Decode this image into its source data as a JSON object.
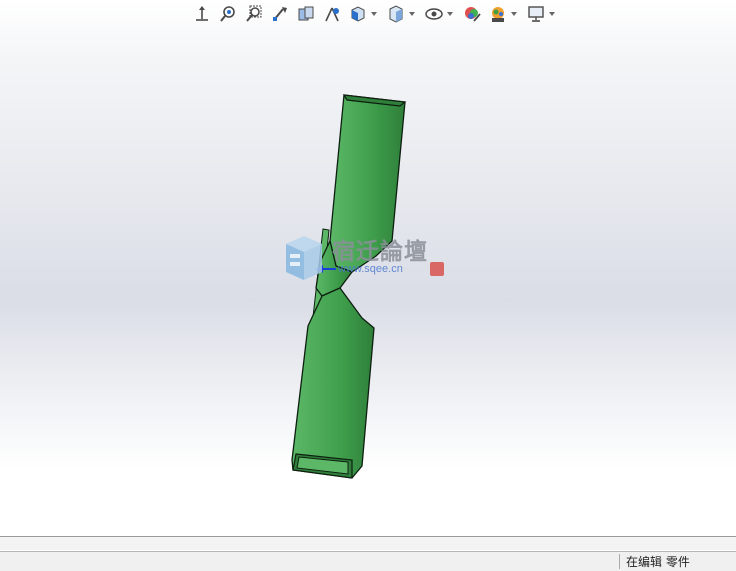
{
  "toolbar": {
    "items": [
      {
        "icon": "view-orientation-icon",
        "dropdown": false
      },
      {
        "icon": "zoom-to-fit-icon",
        "dropdown": false
      },
      {
        "icon": "zoom-to-area-icon",
        "dropdown": false
      },
      {
        "icon": "previous-view-icon",
        "dropdown": false
      },
      {
        "icon": "section-view-icon",
        "dropdown": false
      },
      {
        "icon": "dynamic-annotation-views-icon",
        "dropdown": false
      },
      {
        "icon": "view-orientation-cube-icon",
        "dropdown": true
      },
      {
        "icon": "display-style-icon",
        "dropdown": true
      },
      {
        "icon": "hide-show-items-icon",
        "dropdown": true
      },
      {
        "icon": "edit-appearance-icon",
        "dropdown": false
      },
      {
        "icon": "apply-scene-icon",
        "dropdown": true
      },
      {
        "icon": "view-settings-icon",
        "dropdown": true
      }
    ],
    "colors": {
      "blue": "#2a6fc9",
      "dark": "#4a4a4a"
    }
  },
  "model": {
    "part_color": "#3f9f4c",
    "shade_color": "#2f7f3a",
    "highlight_color": "#5cb867",
    "edge_color": "#0d1f10"
  },
  "watermark": {
    "title": "宿迁論壇",
    "url": "www.sqee.cn"
  },
  "statusbar": {
    "edit_status": "在编辑 零件"
  }
}
